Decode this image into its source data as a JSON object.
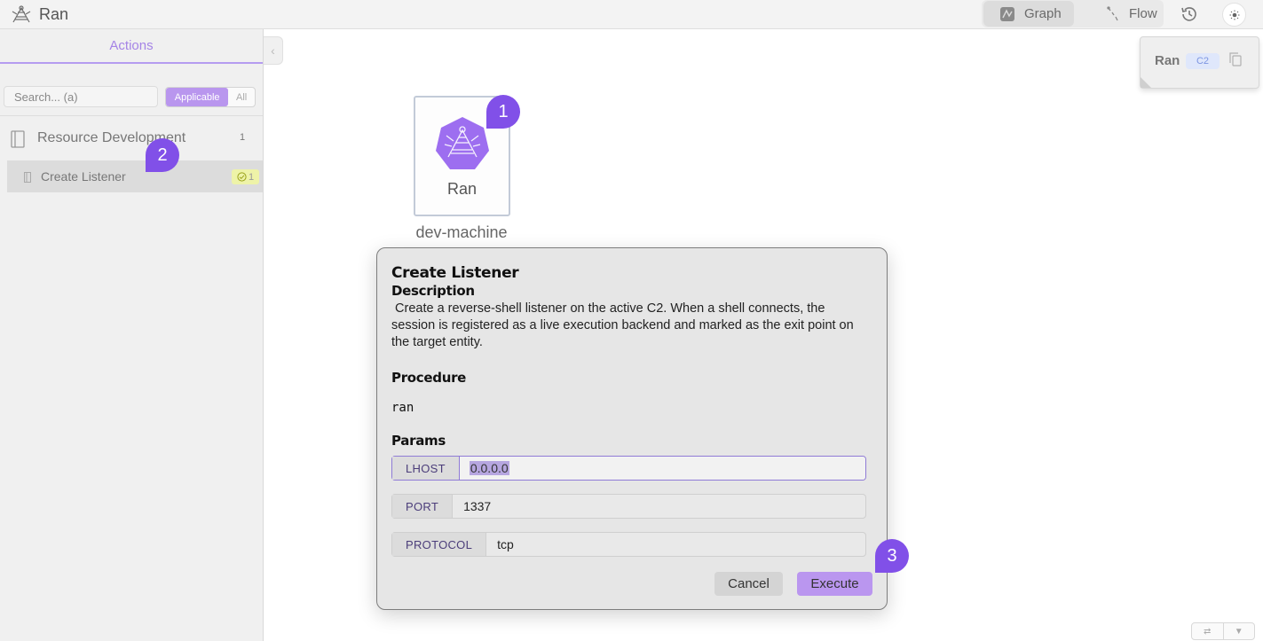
{
  "app": {
    "title": "Ran"
  },
  "topbar": {
    "tabs": [
      {
        "label": "Graph",
        "icon": "graph-icon",
        "active": true
      },
      {
        "label": "Flow",
        "icon": "flow-icon",
        "active": false
      }
    ],
    "history_icon": "history-icon",
    "theme_icon": "sun-icon"
  },
  "sidebar": {
    "header": "Actions",
    "search_placeholder": "Search... (a)",
    "filters": [
      "Applicable",
      "All"
    ],
    "active_filter": "Applicable",
    "groups": [
      {
        "label": "Resource Development",
        "count": "1",
        "items": [
          {
            "label": "Create Listener",
            "badge": "1"
          }
        ]
      }
    ]
  },
  "canvas": {
    "node": {
      "label": "Ran",
      "caption": "dev-machine"
    },
    "context_card": {
      "name": "Ran",
      "tag": "C2"
    }
  },
  "markers": [
    "1",
    "2",
    "3"
  ],
  "modal": {
    "title": "Create Listener",
    "description_label": "Description",
    "description": " Create a reverse-shell listener on the active C2. When a shell connects, the session is registered as a live execution backend and marked as the exit point on the target entity.",
    "procedure_label": "Procedure",
    "procedure": "ran",
    "params_label": "Params",
    "params": [
      {
        "key": "LHOST",
        "value": "0.0.0.0",
        "focused": true
      },
      {
        "key": "PORT",
        "value": "1337"
      },
      {
        "key": "PROTOCOL",
        "value": "tcp"
      }
    ],
    "cancel_label": "Cancel",
    "execute_label": "Execute"
  },
  "colors": {
    "accent": "#b996ee",
    "marker": "#8150e8",
    "node_fill": "#9d6ef0"
  }
}
